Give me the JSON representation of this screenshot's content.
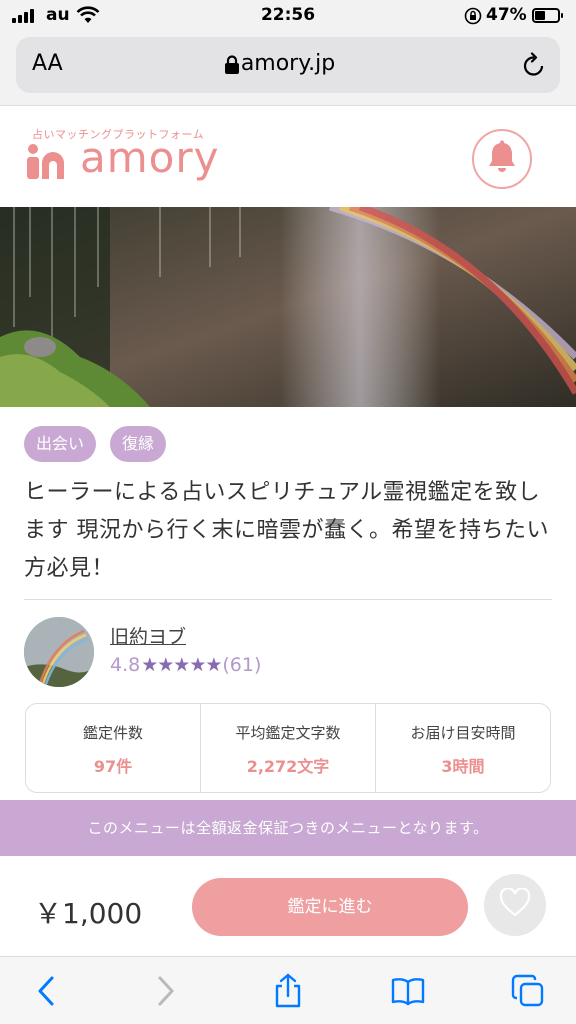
{
  "status_bar": {
    "carrier": "au",
    "time": "22:56",
    "battery": "47%",
    "battery_level": 0.47
  },
  "browser": {
    "text_size_label": "AA",
    "url": "amory.jp"
  },
  "header": {
    "brand_subtitle": "占いマッチングプラットフォーム",
    "brand_name": "amory"
  },
  "tags": [
    "出会い",
    "復縁"
  ],
  "listing": {
    "title": "ヒーラーによる占いスピリチュアル霊視鑑定を致します 現況から行く末に暗雲が蠢く。希望を持ちたい方必見！"
  },
  "advisor": {
    "name": "旧約ヨブ",
    "rating": "4.8",
    "stars": "★★★★★",
    "review_count": "(61)"
  },
  "stats": [
    {
      "label": "鑑定件数",
      "value": "97件"
    },
    {
      "label": "平均鑑定文字数",
      "value": "2,272文字"
    },
    {
      "label": "お届け目安時間",
      "value": "3時間"
    }
  ],
  "guarantee_banner": "このメニューは全額返金保証つきのメニューとなります。",
  "purchase": {
    "price": "￥1,000",
    "cta_label": "鑑定に進む"
  },
  "colors": {
    "accent_pink": "#ec8f8f",
    "tag_purple": "#c9a9d3",
    "star_purple": "#8a6bb0",
    "ios_blue": "#007aff"
  }
}
